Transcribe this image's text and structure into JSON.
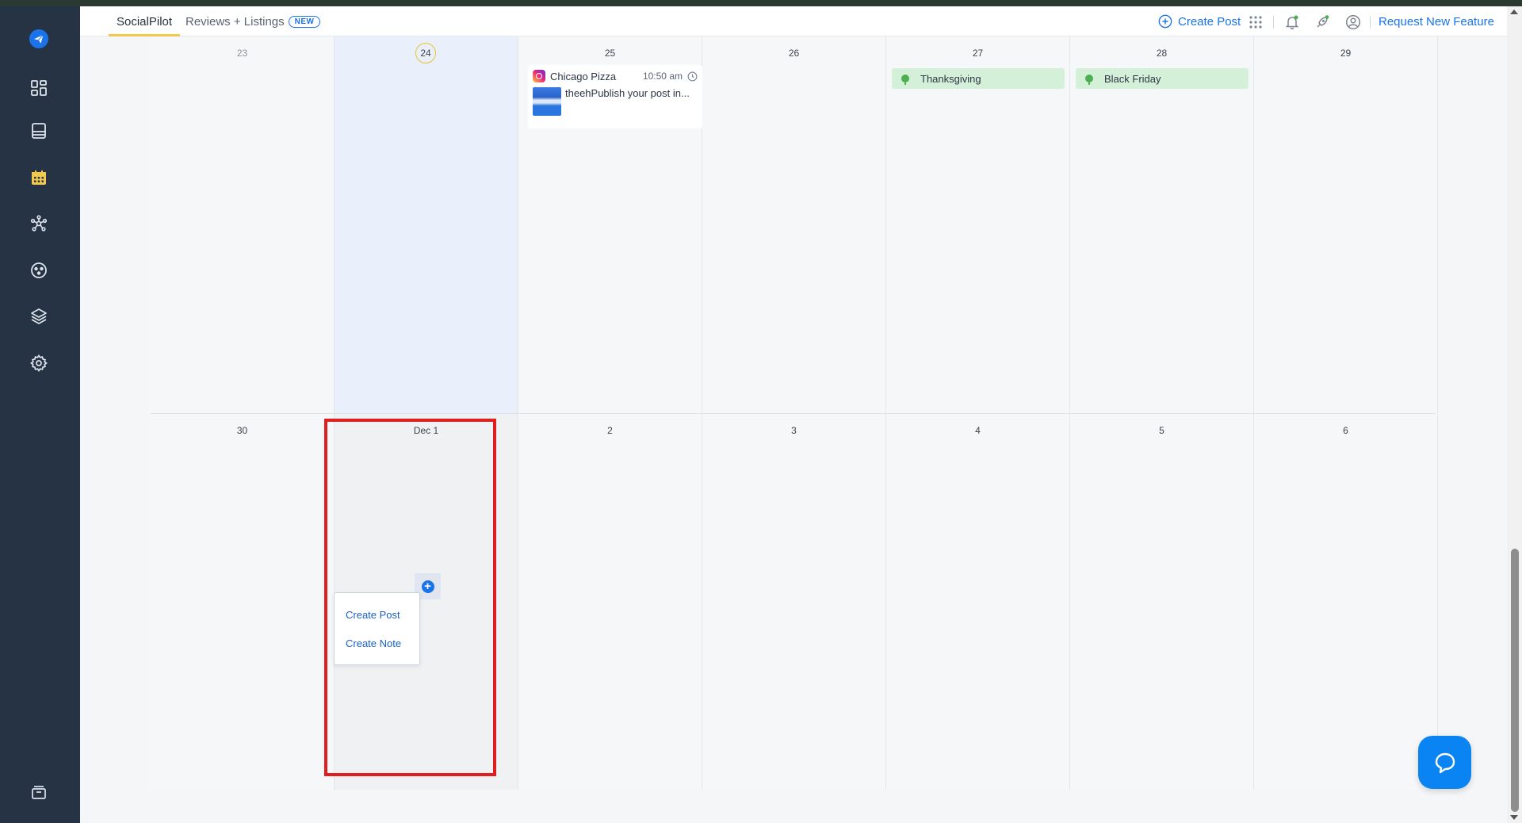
{
  "topbar": {
    "tabs": [
      {
        "label": "SocialPilot"
      },
      {
        "label": "Reviews + Listings",
        "badge": "NEW"
      }
    ],
    "create_post": "Create Post",
    "request_feature": "Request New Feature"
  },
  "sidebar": {
    "icons": [
      "send-logo-icon",
      "dashboard-icon",
      "posts-icon",
      "calendar-icon",
      "connections-icon",
      "analytics-icon",
      "layers-icon",
      "settings-icon",
      "archive-icon"
    ]
  },
  "calendar": {
    "week1": [
      {
        "day": "23"
      },
      {
        "day": "24",
        "today": true
      },
      {
        "day": "25"
      },
      {
        "day": "26"
      },
      {
        "day": "27"
      },
      {
        "day": "28"
      },
      {
        "day": "29"
      }
    ],
    "week2": [
      {
        "day": "30"
      },
      {
        "day": "Dec 1"
      },
      {
        "day": "2"
      },
      {
        "day": "3"
      },
      {
        "day": "4"
      },
      {
        "day": "5"
      },
      {
        "day": "6"
      }
    ],
    "post": {
      "account": "Chicago Pizza",
      "time": "10:50 am",
      "text": "theehPublish your post in..."
    },
    "holidays": [
      {
        "label": "Thanksgiving"
      },
      {
        "label": "Black Friday"
      }
    ],
    "popup": {
      "items": [
        "Create Post",
        "Create Note"
      ]
    }
  },
  "colors": {
    "accent": "#1a73e8",
    "sidebar": "#263345",
    "today_bg": "#e9f0fb",
    "holiday_bg": "#d5f0d8",
    "highlight_border": "#e01e1e",
    "chat": "#0b84f3"
  }
}
